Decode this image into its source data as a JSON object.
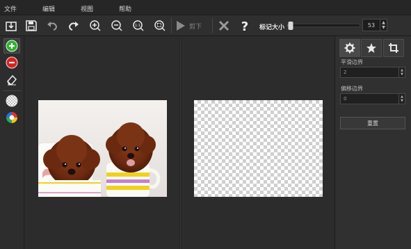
{
  "menu": [
    "文件",
    "编辑",
    "视图",
    "帮助"
  ],
  "toolbar": {
    "cut_label": "剪下",
    "mark_size_label": "标记大小",
    "mark_size_value": "53",
    "mark_size_fraction": 0.05,
    "icons": [
      "open-icon",
      "save-icon",
      "undo-icon",
      "redo-icon",
      "zoom-in-icon",
      "zoom-out-icon",
      "actual-size-icon",
      "fit-icon",
      "play-icon",
      "cancel-icon",
      "help-icon"
    ]
  },
  "tools": [
    "add-mark-icon",
    "remove-mark-icon",
    "eraser-icon",
    "transparent-bg-icon",
    "color-bg-icon"
  ],
  "panel": {
    "smooth_label": "平滑边界",
    "smooth_value": "2",
    "offset_label": "偏移边界",
    "offset_value": "0",
    "reset_label": "重置"
  },
  "colors": {
    "add": "#2db22d",
    "remove": "#d42424",
    "accent": "#d8d8d8"
  }
}
